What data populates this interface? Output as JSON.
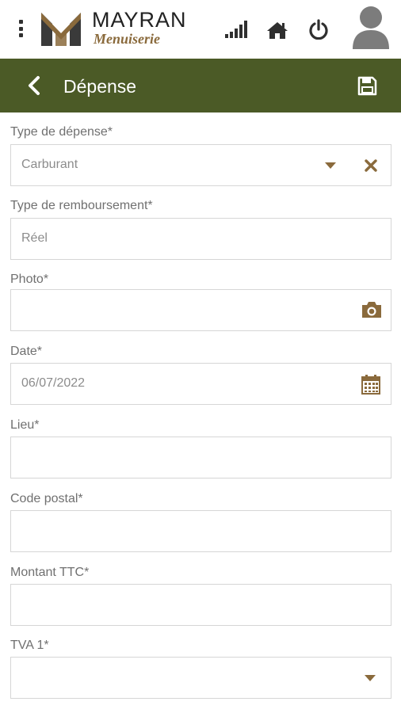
{
  "header": {
    "brand_name": "MAYRAN",
    "brand_sub": "Menuiserie",
    "icons": [
      "menu-icon",
      "signal-icon",
      "home-icon",
      "power-icon",
      "user-avatar-icon"
    ]
  },
  "titlebar": {
    "title": "Dépense",
    "back_icon": "chevron-left-icon",
    "save_icon": "save-icon"
  },
  "form": {
    "type_depense": {
      "label": "Type de dépense*",
      "value": "Carburant"
    },
    "type_remboursement": {
      "label": "Type de remboursement*",
      "value": "Réel"
    },
    "photo": {
      "label": "Photo*",
      "value": ""
    },
    "date": {
      "label": "Date*",
      "value": "06/07/2022"
    },
    "lieu": {
      "label": "Lieu*",
      "value": ""
    },
    "code_postal": {
      "label": "Code postal*",
      "value": ""
    },
    "montant_ttc": {
      "label": "Montant TTC*",
      "value": ""
    },
    "tva1": {
      "label": "TVA 1*",
      "value": ""
    }
  },
  "colors": {
    "brand_green": "#4b5a26",
    "accent_brown": "#8a6a3c",
    "border": "#d6d6d6"
  }
}
